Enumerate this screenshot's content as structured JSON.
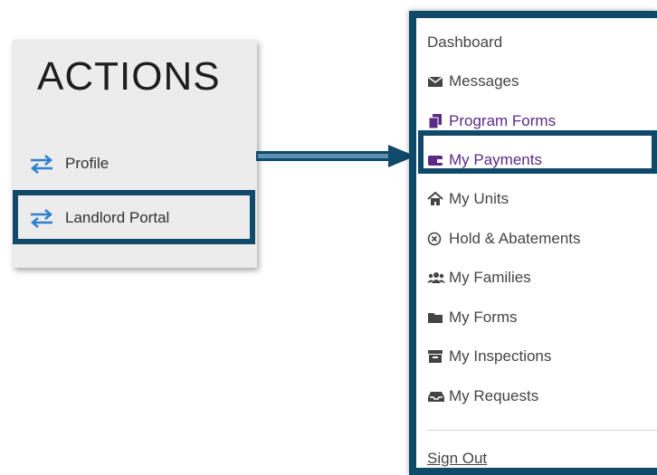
{
  "actions": {
    "title": "ACTIONS",
    "items": [
      {
        "label": "Profile",
        "icon": "transfer-arrows-icon"
      },
      {
        "label": "Landlord Portal",
        "icon": "transfer-arrows-icon"
      }
    ]
  },
  "menu": {
    "items": [
      {
        "label": "Dashboard",
        "icon": ""
      },
      {
        "label": "Messages",
        "icon": "envelope-icon"
      },
      {
        "label": "Program Forms",
        "icon": "copy-icon"
      },
      {
        "label": "My Payments",
        "icon": "wallet-icon"
      },
      {
        "label": "My Units",
        "icon": "home-icon"
      },
      {
        "label": "Hold & Abatements",
        "icon": "circle-x-icon"
      },
      {
        "label": "My Families",
        "icon": "users-icon"
      },
      {
        "label": "My Forms",
        "icon": "folder-icon"
      },
      {
        "label": "My Inspections",
        "icon": "archive-icon"
      },
      {
        "label": "My Requests",
        "icon": "inbox-icon"
      }
    ],
    "sign_out": "Sign Out"
  },
  "colors": {
    "highlight": "#0f4a6b",
    "accent_purple": "#5b2a86",
    "icon_blue": "#2d7fd0",
    "text": "#444444"
  }
}
